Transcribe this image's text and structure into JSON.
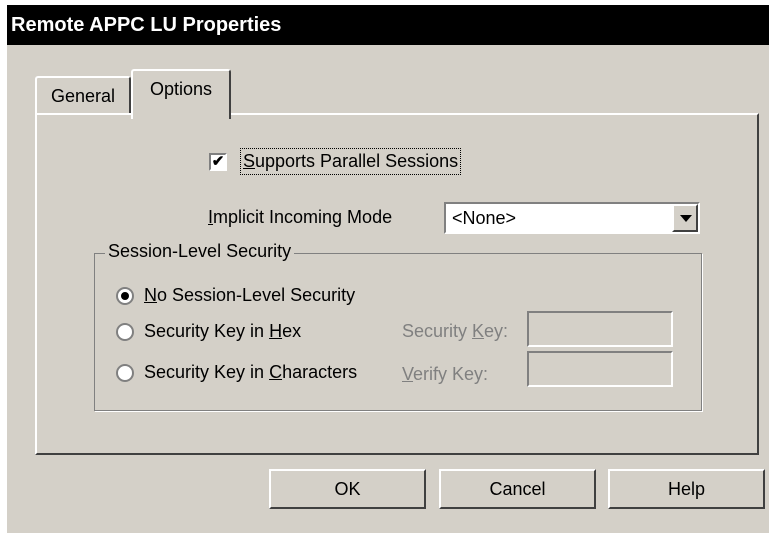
{
  "window": {
    "title": "Remote APPC LU Properties"
  },
  "tabs": [
    {
      "label": "General",
      "active": false
    },
    {
      "label": "Options",
      "active": true
    }
  ],
  "options": {
    "parallel_sessions": {
      "label": "Supports Parallel Sessions",
      "mnemonic": "S",
      "checked": true
    },
    "implicit_mode": {
      "label": "Implicit Incoming Mode",
      "mnemonic": "I",
      "value": "<None>"
    },
    "security_group": {
      "title": "Session-Level Security",
      "radios": [
        {
          "label": "No Session-Level Security",
          "mnemonic": "N",
          "checked": true
        },
        {
          "label": "Security Key in Hex",
          "mnemonic": "H",
          "checked": false
        },
        {
          "label": "Security Key in Characters",
          "mnemonic": "C",
          "checked": false
        }
      ],
      "security_key_label": "Security Key:",
      "verify_key_label": "Verify Key:",
      "security_key_value": "",
      "verify_key_value": ""
    }
  },
  "buttons": {
    "ok": "OK",
    "cancel": "Cancel",
    "help": "Help"
  },
  "colors": {
    "face": "#d4d0c8",
    "title_bg": "#000000",
    "disabled_text": "#808080"
  },
  "icons": {
    "checkmark": "check-icon",
    "dropdown": "chevron-down-icon"
  }
}
